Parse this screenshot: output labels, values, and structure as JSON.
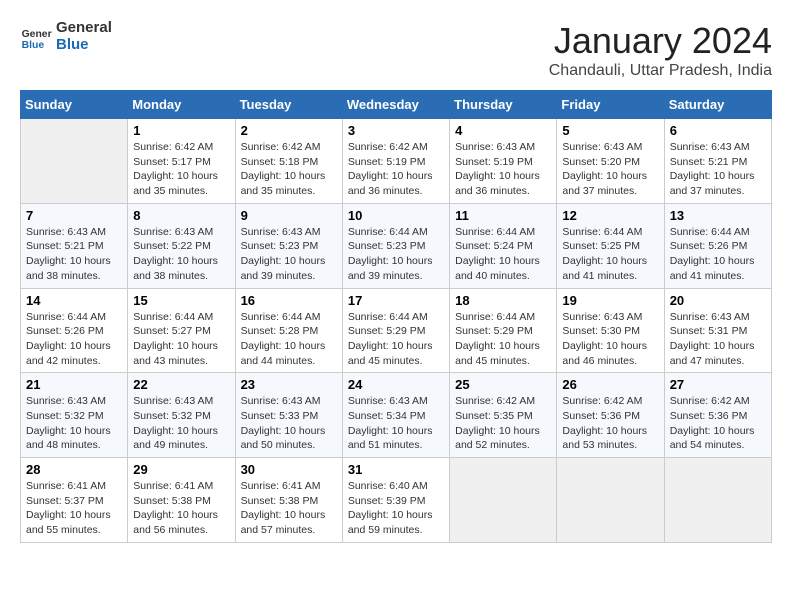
{
  "logo": {
    "line1": "General",
    "line2": "Blue"
  },
  "title": "January 2024",
  "subtitle": "Chandauli, Uttar Pradesh, India",
  "days_of_week": [
    "Sunday",
    "Monday",
    "Tuesday",
    "Wednesday",
    "Thursday",
    "Friday",
    "Saturday"
  ],
  "weeks": [
    [
      {
        "day": "",
        "info": ""
      },
      {
        "day": "1",
        "info": "Sunrise: 6:42 AM\nSunset: 5:17 PM\nDaylight: 10 hours\nand 35 minutes."
      },
      {
        "day": "2",
        "info": "Sunrise: 6:42 AM\nSunset: 5:18 PM\nDaylight: 10 hours\nand 35 minutes."
      },
      {
        "day": "3",
        "info": "Sunrise: 6:42 AM\nSunset: 5:19 PM\nDaylight: 10 hours\nand 36 minutes."
      },
      {
        "day": "4",
        "info": "Sunrise: 6:43 AM\nSunset: 5:19 PM\nDaylight: 10 hours\nand 36 minutes."
      },
      {
        "day": "5",
        "info": "Sunrise: 6:43 AM\nSunset: 5:20 PM\nDaylight: 10 hours\nand 37 minutes."
      },
      {
        "day": "6",
        "info": "Sunrise: 6:43 AM\nSunset: 5:21 PM\nDaylight: 10 hours\nand 37 minutes."
      }
    ],
    [
      {
        "day": "7",
        "info": "Sunrise: 6:43 AM\nSunset: 5:21 PM\nDaylight: 10 hours\nand 38 minutes."
      },
      {
        "day": "8",
        "info": "Sunrise: 6:43 AM\nSunset: 5:22 PM\nDaylight: 10 hours\nand 38 minutes."
      },
      {
        "day": "9",
        "info": "Sunrise: 6:43 AM\nSunset: 5:23 PM\nDaylight: 10 hours\nand 39 minutes."
      },
      {
        "day": "10",
        "info": "Sunrise: 6:44 AM\nSunset: 5:23 PM\nDaylight: 10 hours\nand 39 minutes."
      },
      {
        "day": "11",
        "info": "Sunrise: 6:44 AM\nSunset: 5:24 PM\nDaylight: 10 hours\nand 40 minutes."
      },
      {
        "day": "12",
        "info": "Sunrise: 6:44 AM\nSunset: 5:25 PM\nDaylight: 10 hours\nand 41 minutes."
      },
      {
        "day": "13",
        "info": "Sunrise: 6:44 AM\nSunset: 5:26 PM\nDaylight: 10 hours\nand 41 minutes."
      }
    ],
    [
      {
        "day": "14",
        "info": "Sunrise: 6:44 AM\nSunset: 5:26 PM\nDaylight: 10 hours\nand 42 minutes."
      },
      {
        "day": "15",
        "info": "Sunrise: 6:44 AM\nSunset: 5:27 PM\nDaylight: 10 hours\nand 43 minutes."
      },
      {
        "day": "16",
        "info": "Sunrise: 6:44 AM\nSunset: 5:28 PM\nDaylight: 10 hours\nand 44 minutes."
      },
      {
        "day": "17",
        "info": "Sunrise: 6:44 AM\nSunset: 5:29 PM\nDaylight: 10 hours\nand 45 minutes."
      },
      {
        "day": "18",
        "info": "Sunrise: 6:44 AM\nSunset: 5:29 PM\nDaylight: 10 hours\nand 45 minutes."
      },
      {
        "day": "19",
        "info": "Sunrise: 6:43 AM\nSunset: 5:30 PM\nDaylight: 10 hours\nand 46 minutes."
      },
      {
        "day": "20",
        "info": "Sunrise: 6:43 AM\nSunset: 5:31 PM\nDaylight: 10 hours\nand 47 minutes."
      }
    ],
    [
      {
        "day": "21",
        "info": "Sunrise: 6:43 AM\nSunset: 5:32 PM\nDaylight: 10 hours\nand 48 minutes."
      },
      {
        "day": "22",
        "info": "Sunrise: 6:43 AM\nSunset: 5:32 PM\nDaylight: 10 hours\nand 49 minutes."
      },
      {
        "day": "23",
        "info": "Sunrise: 6:43 AM\nSunset: 5:33 PM\nDaylight: 10 hours\nand 50 minutes."
      },
      {
        "day": "24",
        "info": "Sunrise: 6:43 AM\nSunset: 5:34 PM\nDaylight: 10 hours\nand 51 minutes."
      },
      {
        "day": "25",
        "info": "Sunrise: 6:42 AM\nSunset: 5:35 PM\nDaylight: 10 hours\nand 52 minutes."
      },
      {
        "day": "26",
        "info": "Sunrise: 6:42 AM\nSunset: 5:36 PM\nDaylight: 10 hours\nand 53 minutes."
      },
      {
        "day": "27",
        "info": "Sunrise: 6:42 AM\nSunset: 5:36 PM\nDaylight: 10 hours\nand 54 minutes."
      }
    ],
    [
      {
        "day": "28",
        "info": "Sunrise: 6:41 AM\nSunset: 5:37 PM\nDaylight: 10 hours\nand 55 minutes."
      },
      {
        "day": "29",
        "info": "Sunrise: 6:41 AM\nSunset: 5:38 PM\nDaylight: 10 hours\nand 56 minutes."
      },
      {
        "day": "30",
        "info": "Sunrise: 6:41 AM\nSunset: 5:38 PM\nDaylight: 10 hours\nand 57 minutes."
      },
      {
        "day": "31",
        "info": "Sunrise: 6:40 AM\nSunset: 5:39 PM\nDaylight: 10 hours\nand 59 minutes."
      },
      {
        "day": "",
        "info": ""
      },
      {
        "day": "",
        "info": ""
      },
      {
        "day": "",
        "info": ""
      }
    ]
  ]
}
